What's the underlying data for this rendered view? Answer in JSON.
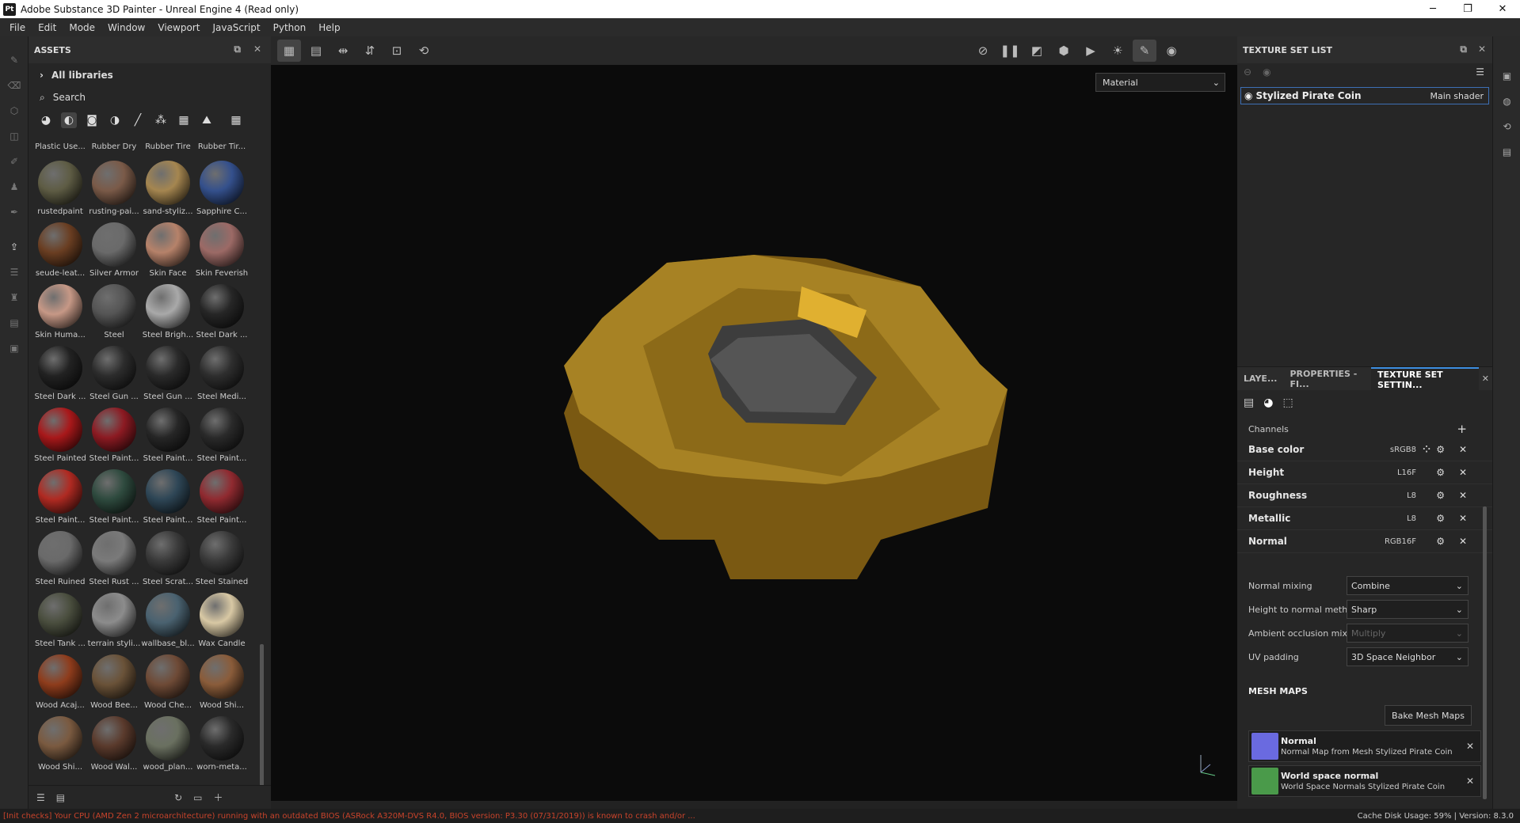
{
  "window": {
    "title": "Adobe Substance 3D Painter - Unreal Engine 4 (Read only)",
    "logo": "Pt",
    "controls": [
      "─",
      "❐",
      "✕"
    ]
  },
  "menu": [
    "File",
    "Edit",
    "Mode",
    "Window",
    "Viewport",
    "JavaScript",
    "Python",
    "Help"
  ],
  "assets": {
    "title": "ASSETS",
    "library": "All libraries",
    "search_placeholder": "Search",
    "top_captions": [
      "Plastic Use...",
      "Rubber Dry",
      "Rubber Tire",
      "Rubber Tir..."
    ],
    "materials": [
      [
        "rustedpaint",
        "rusting-pai...",
        "sand-styliz...",
        "Sapphire C..."
      ],
      [
        "seude-leat...",
        "Silver Armor",
        "Skin Face",
        "Skin Feverish"
      ],
      [
        "Skin Huma...",
        "Steel",
        "Steel Brigh...",
        "Steel Dark ..."
      ],
      [
        "Steel Dark ...",
        "Steel Gun ...",
        "Steel Gun ...",
        "Steel Medi..."
      ],
      [
        "Steel Painted",
        "Steel Paint...",
        "Steel Paint...",
        "Steel Paint..."
      ],
      [
        "Steel Paint...",
        "Steel Paint...",
        "Steel Paint...",
        "Steel Paint..."
      ],
      [
        "Steel Ruined",
        "Steel Rust ...",
        "Steel Scrat...",
        "Steel Stained"
      ],
      [
        "Steel Tank ...",
        "terrain styli...",
        "wallbase_bl...",
        "Wax Candle"
      ],
      [
        "Wood Acaj...",
        "Wood Bee...",
        "Wood Che...",
        "Wood Shi..."
      ],
      [
        "Wood Shi...",
        "Wood Wal...",
        "wood_plan...",
        "worn-meta..."
      ]
    ],
    "colors": [
      [
        "#5e5c44",
        "#7a5a48",
        "#a58650",
        "#34508c"
      ],
      [
        "#6a3e22",
        "#6a6a6a",
        "#b6826a",
        "#9c6a66"
      ],
      [
        "#c69886",
        "#555555",
        "#a9a9a9",
        "#262626"
      ],
      [
        "#222222",
        "#2c2c2c",
        "#2a2a2a",
        "#2e2e2e"
      ],
      [
        "#a8181a",
        "#8c1a22",
        "#262626",
        "#2a2a2a"
      ],
      [
        "#b02a22",
        "#2e4a3e",
        "#2e4656",
        "#902a30"
      ],
      [
        "#6a6a6a",
        "#7a7a7a",
        "#3a3a3a",
        "#3a3a3a"
      ],
      [
        "#4a4e3e",
        "#8c8c8c",
        "#4a6270",
        "#d8c8a4"
      ],
      [
        "#8e3c1c",
        "#6a5238",
        "#6e4a36",
        "#8a5c3a"
      ],
      [
        "#7a5a40",
        "#5a3a2c",
        "#6a7060",
        "#2a2a2a"
      ]
    ]
  },
  "viewport": {
    "shading": "Material"
  },
  "texture_set_list": {
    "title": "TEXTURE SET LIST",
    "set_name": "Stylized Pirate Coin",
    "shader": "Main shader"
  },
  "tabs": [
    "LAYE...",
    "PROPERTIES - FI...",
    "TEXTURE SET SETTIN..."
  ],
  "texture_set_settings": {
    "channels_label": "Channels",
    "channels": [
      {
        "name": "Base color",
        "format": "sRGB8"
      },
      {
        "name": "Height",
        "format": "L16F"
      },
      {
        "name": "Roughness",
        "format": "L8"
      },
      {
        "name": "Metallic",
        "format": "L8"
      },
      {
        "name": "Normal",
        "format": "RGB16F"
      }
    ],
    "props": [
      {
        "label": "Normal mixing",
        "value": "Combine"
      },
      {
        "label": "Height to normal method",
        "value": "Sharp"
      },
      {
        "label": "Ambient occlusion mixing",
        "value": "Multiply"
      },
      {
        "label": "UV padding",
        "value": "3D Space Neighbor"
      }
    ],
    "mesh_maps_title": "MESH MAPS",
    "bake_button": "Bake Mesh Maps",
    "mesh_maps": [
      {
        "title": "Normal",
        "desc": "Normal Map from Mesh Stylized Pirate Coin"
      },
      {
        "title": "World space normal",
        "desc": "World Space Normals Stylized Pirate Coin"
      }
    ]
  },
  "status": {
    "warning": "[Init checks] Your CPU (AMD Zen 2 microarchitecture) running with an outdated BIOS (ASRock A320M-DVS R4.0, BIOS version: P3.30 (07/31/2019)) is known to crash and/or ...",
    "cache": "Cache Disk Usage:    59% | Version: 8.3.0"
  }
}
